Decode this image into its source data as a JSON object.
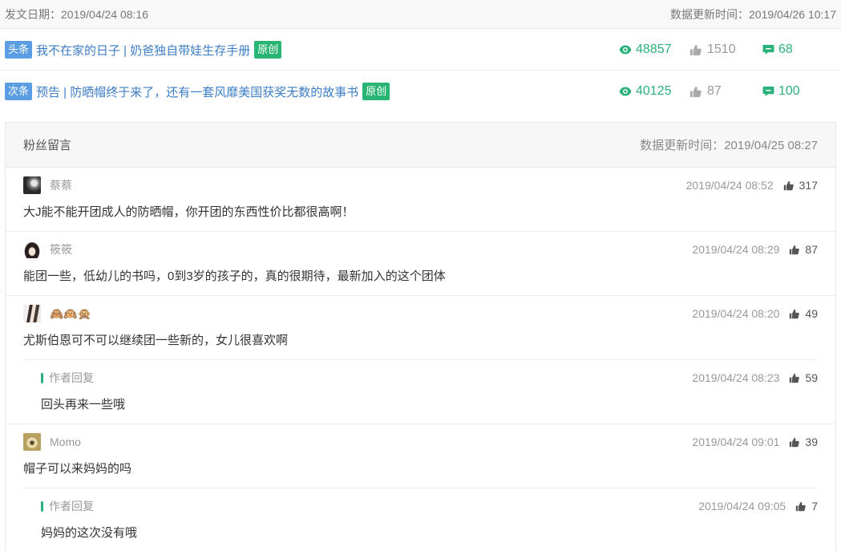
{
  "meta": {
    "publish_date": "发文日期：2019/04/24 08:16",
    "update_time": "数据更新时间：2019/04/26 10:17"
  },
  "articles": [
    {
      "position": "头条",
      "title": "我不在家的日子 | 奶爸独自带娃生存手册",
      "badge": "原创",
      "views": "48857",
      "likes": "1510",
      "comments": "68"
    },
    {
      "position": "次条",
      "title": "预告 | 防晒帽终于来了，还有一套风靡美国获奖无数的故事书",
      "badge": "原创",
      "views": "40125",
      "likes": "87",
      "comments": "100"
    }
  ],
  "comments_panel": {
    "title": "粉丝留言",
    "update_time": "数据更新时间：2019/04/25 08:27",
    "comments": [
      {
        "name": "蔡蔡",
        "time": "2019/04/24 08:52",
        "likes": "317",
        "text": "大J能不能开团成人的防晒帽，你开团的东西性价比都很高啊！"
      },
      {
        "name": "筱筱",
        "time": "2019/04/24 08:29",
        "likes": "87",
        "text": "能团一些，低幼儿的书吗，0到3岁的孩子的，真的很期待，最新加入的这个团体"
      },
      {
        "name": "🙈🙉🙊",
        "time": "2019/04/24 08:20",
        "likes": "49",
        "text": "尤斯伯恩可不可以继续团一些新的，女儿很喜欢啊",
        "reply": {
          "label": "作者回复",
          "time": "2019/04/24 08:23",
          "likes": "59",
          "text": "回头再来一些哦"
        }
      },
      {
        "name": "Momo",
        "time": "2019/04/24 09:01",
        "likes": "39",
        "text": "帽子可以来妈妈的吗",
        "reply": {
          "label": "作者回复",
          "time": "2019/04/24 09:05",
          "likes": "7",
          "text": "妈妈的这次没有哦"
        }
      }
    ]
  },
  "icons": {
    "views": "eye-icon",
    "likes": "thumbs-up-icon",
    "comments": "comment-icon"
  },
  "colors": {
    "accent_green": "#2bb27a",
    "title_blue": "#3c7dc6",
    "badge_blue": "#5b9de3",
    "badge_green": "#28b573",
    "muted": "#999999",
    "text": "#333333"
  }
}
